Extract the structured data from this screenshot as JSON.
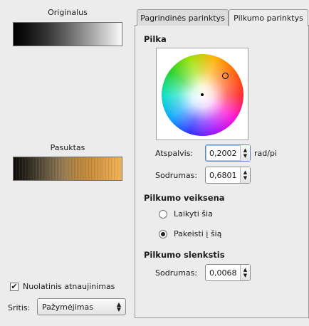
{
  "left": {
    "original_title": "Originalus",
    "rotated_title": "Pasuktas",
    "continuous_update": {
      "label": "Nuolatinis atnaujinimas",
      "checked": true
    },
    "area": {
      "label": "Sritis:",
      "value": "Pažymėjimas"
    }
  },
  "tabs": [
    {
      "label": "Pagrindinės parinktys",
      "active": false
    },
    {
      "label": "Pilkumo parinktys",
      "active": true
    }
  ],
  "gray": {
    "title": "Pilka",
    "hue": {
      "label": "Atspalvis:",
      "value": "0,2002",
      "unit": "rad/pi"
    },
    "saturation": {
      "label": "Sodrumas:",
      "value": "0,6801"
    }
  },
  "mode": {
    "title": "Pilkumo veiksena",
    "options": [
      {
        "label": "Laikyti šia",
        "selected": false
      },
      {
        "label": "Pakeisti į šią",
        "selected": true
      }
    ]
  },
  "threshold": {
    "title": "Pilkumo slenkstis",
    "saturation": {
      "label": "Sodrumas:",
      "value": "0,0068"
    }
  }
}
